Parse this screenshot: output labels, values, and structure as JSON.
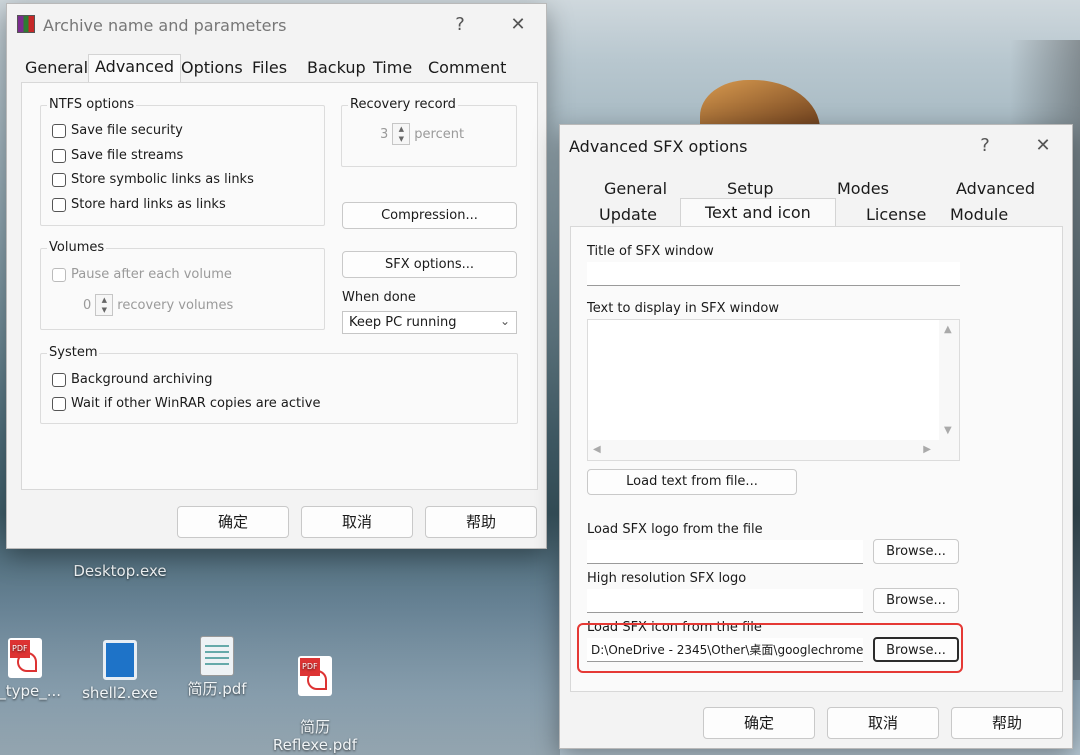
{
  "desktop": {
    "icons": [
      {
        "label": "Desktop.exe"
      },
      {
        "label": "e_type_..."
      },
      {
        "label": "shell2.exe"
      },
      {
        "label": "简历.pdf"
      },
      {
        "label": "简历\nReflexe.pdf"
      }
    ]
  },
  "archive_dialog": {
    "title": "Archive name and parameters",
    "help": "?",
    "close": "✕",
    "tabs": [
      "General",
      "Advanced",
      "Options",
      "Files",
      "Backup",
      "Time",
      "Comment"
    ],
    "active_tab": "Advanced",
    "ntfs": {
      "label": "NTFS options",
      "items": [
        "Save file security",
        "Save file streams",
        "Store symbolic links as links",
        "Store hard links as links"
      ]
    },
    "recovery": {
      "label": "Recovery record",
      "value": "3",
      "unit": "percent"
    },
    "compression_button": "Compression...",
    "volumes": {
      "label": "Volumes",
      "pause_label": "Pause after each volume",
      "recovery_value": "0",
      "recovery_unit": "recovery volumes"
    },
    "sfx_button": "SFX options...",
    "when_done": {
      "label": "When done",
      "selected": "Keep PC running"
    },
    "system": {
      "label": "System",
      "items": [
        "Background archiving",
        "Wait if other WinRAR copies are active"
      ]
    },
    "buttons": {
      "ok": "确定",
      "cancel": "取消",
      "help": "帮助"
    }
  },
  "sfx_dialog": {
    "title": "Advanced SFX options",
    "help": "?",
    "close": "✕",
    "tabs_row1": [
      "General",
      "Setup",
      "Modes",
      "Advanced"
    ],
    "tabs_row2": [
      "Update",
      "Text and icon",
      "License",
      "Module"
    ],
    "active_tab": "Text and icon",
    "title_label": "Title of SFX window",
    "title_value": "",
    "text_label": "Text to display in SFX window",
    "load_text_button": "Load text from file...",
    "logo_label": "Load SFX logo from the file",
    "logo_value": "",
    "hires_label": "High resolution SFX logo",
    "hires_value": "",
    "icon_label": "Load SFX icon from the file",
    "icon_value": "D:\\OneDrive - 2345\\Other\\桌面\\googlechrome",
    "browse": "Browse...",
    "buttons": {
      "ok": "确定",
      "cancel": "取消",
      "help": "帮助"
    },
    "highlight_color": "#e53935"
  }
}
